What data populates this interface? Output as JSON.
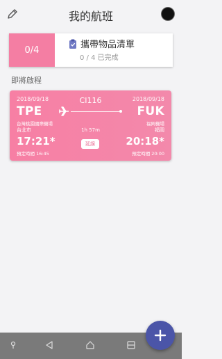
{
  "header": {
    "title": "我的航班"
  },
  "checklist": {
    "count": "0/4",
    "title": "攜帶物品清單",
    "subtitle": "0 / 4 已完成"
  },
  "upcoming": {
    "section_title": "即將啟程"
  },
  "flight": {
    "flight_number": "CI116",
    "dep_date": "2018/09/18",
    "arr_date": "2018/09/18",
    "dep_code": "TPE",
    "arr_code": "FUK",
    "dep_airport": "台灣桃園國際機場",
    "arr_airport": "福岡機場",
    "dep_city": "台北市",
    "arr_city": "福岡",
    "duration": "1h 57m",
    "dep_time": "17:21*",
    "arr_time": "20:18*",
    "status": "延誤",
    "dep_scheduled": "預定時間 16:45",
    "arr_scheduled": "預定時間 20:00"
  },
  "colors": {
    "card_pink": "#f77fa4",
    "fab": "#4b55a8",
    "navbar": "#7a7a7a"
  },
  "icons": {
    "edit": "pencil-icon",
    "checklist": "clipboard-icon",
    "plane": "airplane-icon",
    "fab": "plus-icon"
  }
}
